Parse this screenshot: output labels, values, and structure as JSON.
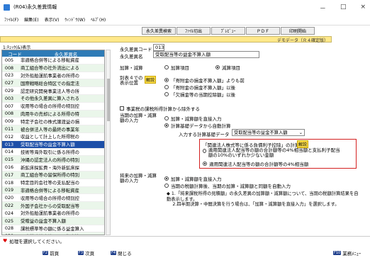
{
  "window": {
    "title": "(R04)永久差異情報",
    "min": "－",
    "max": "□",
    "close": "×"
  },
  "menu": [
    "ﾌｧｲﾙ(F)",
    "編集(E)",
    "表示(V)",
    "ｳｨﾝﾄﾞｳ(W)",
    "ﾍﾙﾌﾟ(H)"
  ],
  "toolbar": [
    "永久差異検索",
    "ﾌｧｲﾙ切出",
    "ﾌﾟﾚﾋﾞｭｰ",
    "ＰＤＦ",
    "印刷開始"
  ],
  "mode_label": "デモデータ（Ｒ４確定版）",
  "section_label": "1:ﾁｪｯｸ(&)表示",
  "list": {
    "col_code": "コード",
    "col_name": "永久差異名",
    "rows": [
      [
        "005",
        "非適格合併等による移転資産"
      ],
      [
        "008",
        "商工組合等の社外流出による"
      ],
      [
        "023",
        "対外船舶運航事業者の所得の"
      ],
      [
        "027",
        "国際戦略総合特区での指定法"
      ],
      [
        "029",
        "認定研究開発事業法人等の所"
      ],
      [
        "003",
        "その他永久差異に算入される"
      ],
      [
        "007",
        "収用等の場合の所得の特別控"
      ],
      [
        "008",
        "肉用牛の売却による所得の特"
      ],
      [
        "009",
        "特定子会社の株式譲渡益の損"
      ],
      [
        "011",
        "被合併法人等の最終の事業年"
      ],
      [
        "012",
        "収益として計上した所得税の"
      ],
      [
        "013",
        "受取配当等の益金不算入額"
      ],
      [
        "014",
        "技術等海外取引に係る所得の"
      ],
      [
        "015",
        "沖縄の認定法人の所得の特別"
      ],
      [
        "016",
        "新鉱床探鉱費・海外新鉱床探"
      ],
      [
        "017",
        "商工組合等の留保所得の特別"
      ],
      [
        "018",
        "特定目的会社等の支払配当の"
      ],
      [
        "019",
        "非適格合併等による移転資産"
      ],
      [
        "020",
        "収用等の場合の所得の特別控"
      ],
      [
        "022",
        "外国子会社からの受取配当等"
      ],
      [
        "024",
        "対外船舶運航事業者の所得の"
      ],
      [
        "025",
        "受贈益の益金不算入額"
      ],
      [
        "028",
        "課税標準等の額に係る益金算入"
      ],
      [
        "030",
        "国際戦略総合特区での指定法"
      ]
    ],
    "selected_index": 11
  },
  "form": {
    "code_label": "永久差異コード",
    "code_value": "013",
    "name_label": "永久差異名",
    "name_value": "受取配当等の益金不算入額",
    "addsub_label": "加算・減算",
    "addsub_options": [
      "加算項目",
      "減算項目"
    ],
    "addsub_selected": 1,
    "display_label": "別表４での表示位置",
    "display_badge": "解説",
    "display_options": [
      "「寄附金の損金不算入額」よりも前",
      "「寄附金の損金不算入額」以後",
      "「欠損金等の当期控除額」以後"
    ],
    "display_selected": 0,
    "exclude_label": "事業税の課税所得計算から除外する",
    "calc_label": "当期の加算・減算額の入力",
    "calc_options": [
      "加算・減算額を直接入力",
      "計算基礎データから自動計算"
    ],
    "calc_selected": 1,
    "input_data_label": "入力する計算基礎データ",
    "input_data_value": "受取配当等の益金不算入額",
    "red_title": "「関連法人株式等に係る負債利子控除」の計算方法",
    "red_badge": "解説",
    "red_options": [
      "適用関連法人配当等の額の合計額等の4%相当額と支払利子配当額の10%のいずれか少ない金額",
      "適用関連法人配当等の額の合計額等の4%相当額"
    ],
    "red_selected": 1,
    "next_label": "将来の加算・減算額の入力",
    "next_options": [
      "加算・減算額を直接入力",
      "当期の税額計算後、当期の加算・減算額と同額を自動入力"
    ],
    "next_selected": 0
  },
  "notes": [
    "1.「将来課税所得の見積額」の永久差異の加算額・減算額について、当期の税額計算結果を自動表示します。",
    "2.四半期決算・中間決算を行う場合は、「加算・減算額を直接入力」を選択します。"
  ],
  "status": "処理を選択してください。",
  "fkeys": [
    {
      "key": "F2",
      "label": "前頁"
    },
    {
      "key": "F3",
      "label": "次頁"
    },
    {
      "key": "F4",
      "label": "閉じる"
    },
    {
      "key": "F10",
      "label": "業務ﾒﾆｭｰ"
    }
  ]
}
